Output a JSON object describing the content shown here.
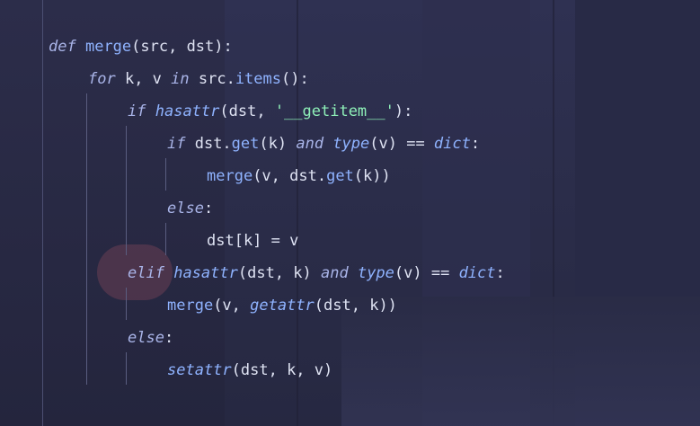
{
  "code": {
    "lines": [
      "def merge(src, dst):",
      "for k, v in src.items():",
      "if hasattr(dst, '__getitem__'):",
      "if dst.get(k) and type(v) == dict:",
      "merge(v, dst.get(k))",
      "else:",
      "dst[k] = v",
      "elif hasattr(dst, k) and type(v) == dict:",
      "merge(v, getattr(dst, k))",
      "else:",
      "setattr(dst, k, v)"
    ],
    "tokens": {
      "l1": [
        "def",
        "merge",
        "(src, dst):"
      ],
      "l2": [
        "for",
        " k, v ",
        "in",
        " src.",
        "items",
        "():"
      ],
      "l3": [
        "if",
        "hasattr",
        "(dst, ",
        "'__getitem__'",
        "):"
      ],
      "l4": [
        "if",
        " dst.",
        "get",
        "(k) ",
        "and",
        "type",
        "(v) == ",
        "dict",
        ":"
      ],
      "l5": [
        "merge",
        "(v, dst.",
        "get",
        "(k))"
      ],
      "l6": [
        "else",
        ":"
      ],
      "l7": [
        "dst[k] = v"
      ],
      "l8": [
        "elif",
        "hasattr",
        "(dst, k) ",
        "and",
        "type",
        "(v) == ",
        "dict",
        ":"
      ],
      "l9": [
        "merge",
        "(v, ",
        "getattr",
        "(dst, k))"
      ],
      "l10": [
        "else",
        ":"
      ],
      "l11": [
        "setattr",
        "(dst, k, v)"
      ]
    }
  },
  "colors": {
    "background": "#2a2c48",
    "keyword": "#a9b4e8",
    "function": "#8fb3ff",
    "string": "#8ef0b8",
    "text": "#dfe3f3"
  }
}
